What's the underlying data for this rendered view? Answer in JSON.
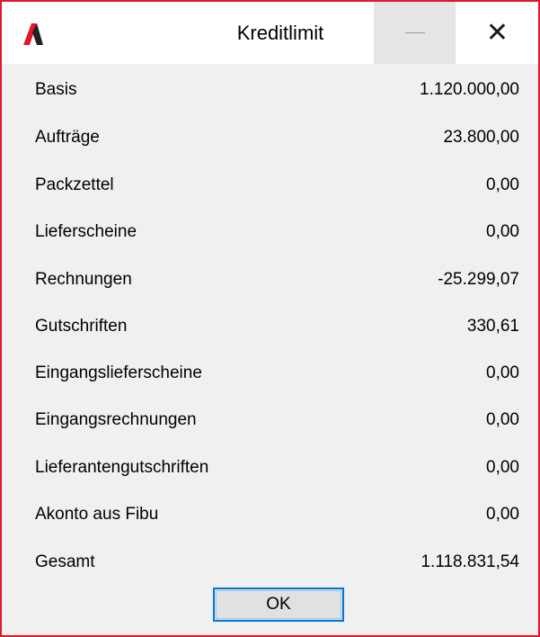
{
  "window": {
    "title": "Kreditlimit",
    "accent_color": "#e0182f",
    "icons": {
      "logo": "app-logo-icon",
      "minimize": "minimize-icon",
      "close": "close-icon"
    },
    "close_glyph": "✕"
  },
  "rows": [
    {
      "label": "Basis",
      "value": "1.120.000,00"
    },
    {
      "label": "Aufträge",
      "value": "23.800,00"
    },
    {
      "label": "Packzettel",
      "value": "0,00"
    },
    {
      "label": "Lieferscheine",
      "value": "0,00"
    },
    {
      "label": "Rechnungen",
      "value": "-25.299,07"
    },
    {
      "label": "Gutschriften",
      "value": "330,61"
    },
    {
      "label": "Eingangslieferscheine",
      "value": "0,00"
    },
    {
      "label": "Eingangsrechnungen",
      "value": "0,00"
    },
    {
      "label": "Lieferantengutschriften",
      "value": "0,00"
    },
    {
      "label": "Akonto aus Fibu",
      "value": "0,00"
    },
    {
      "label": "Gesamt",
      "value": "1.118.831,54"
    }
  ],
  "ok_button": {
    "label": "OK"
  }
}
